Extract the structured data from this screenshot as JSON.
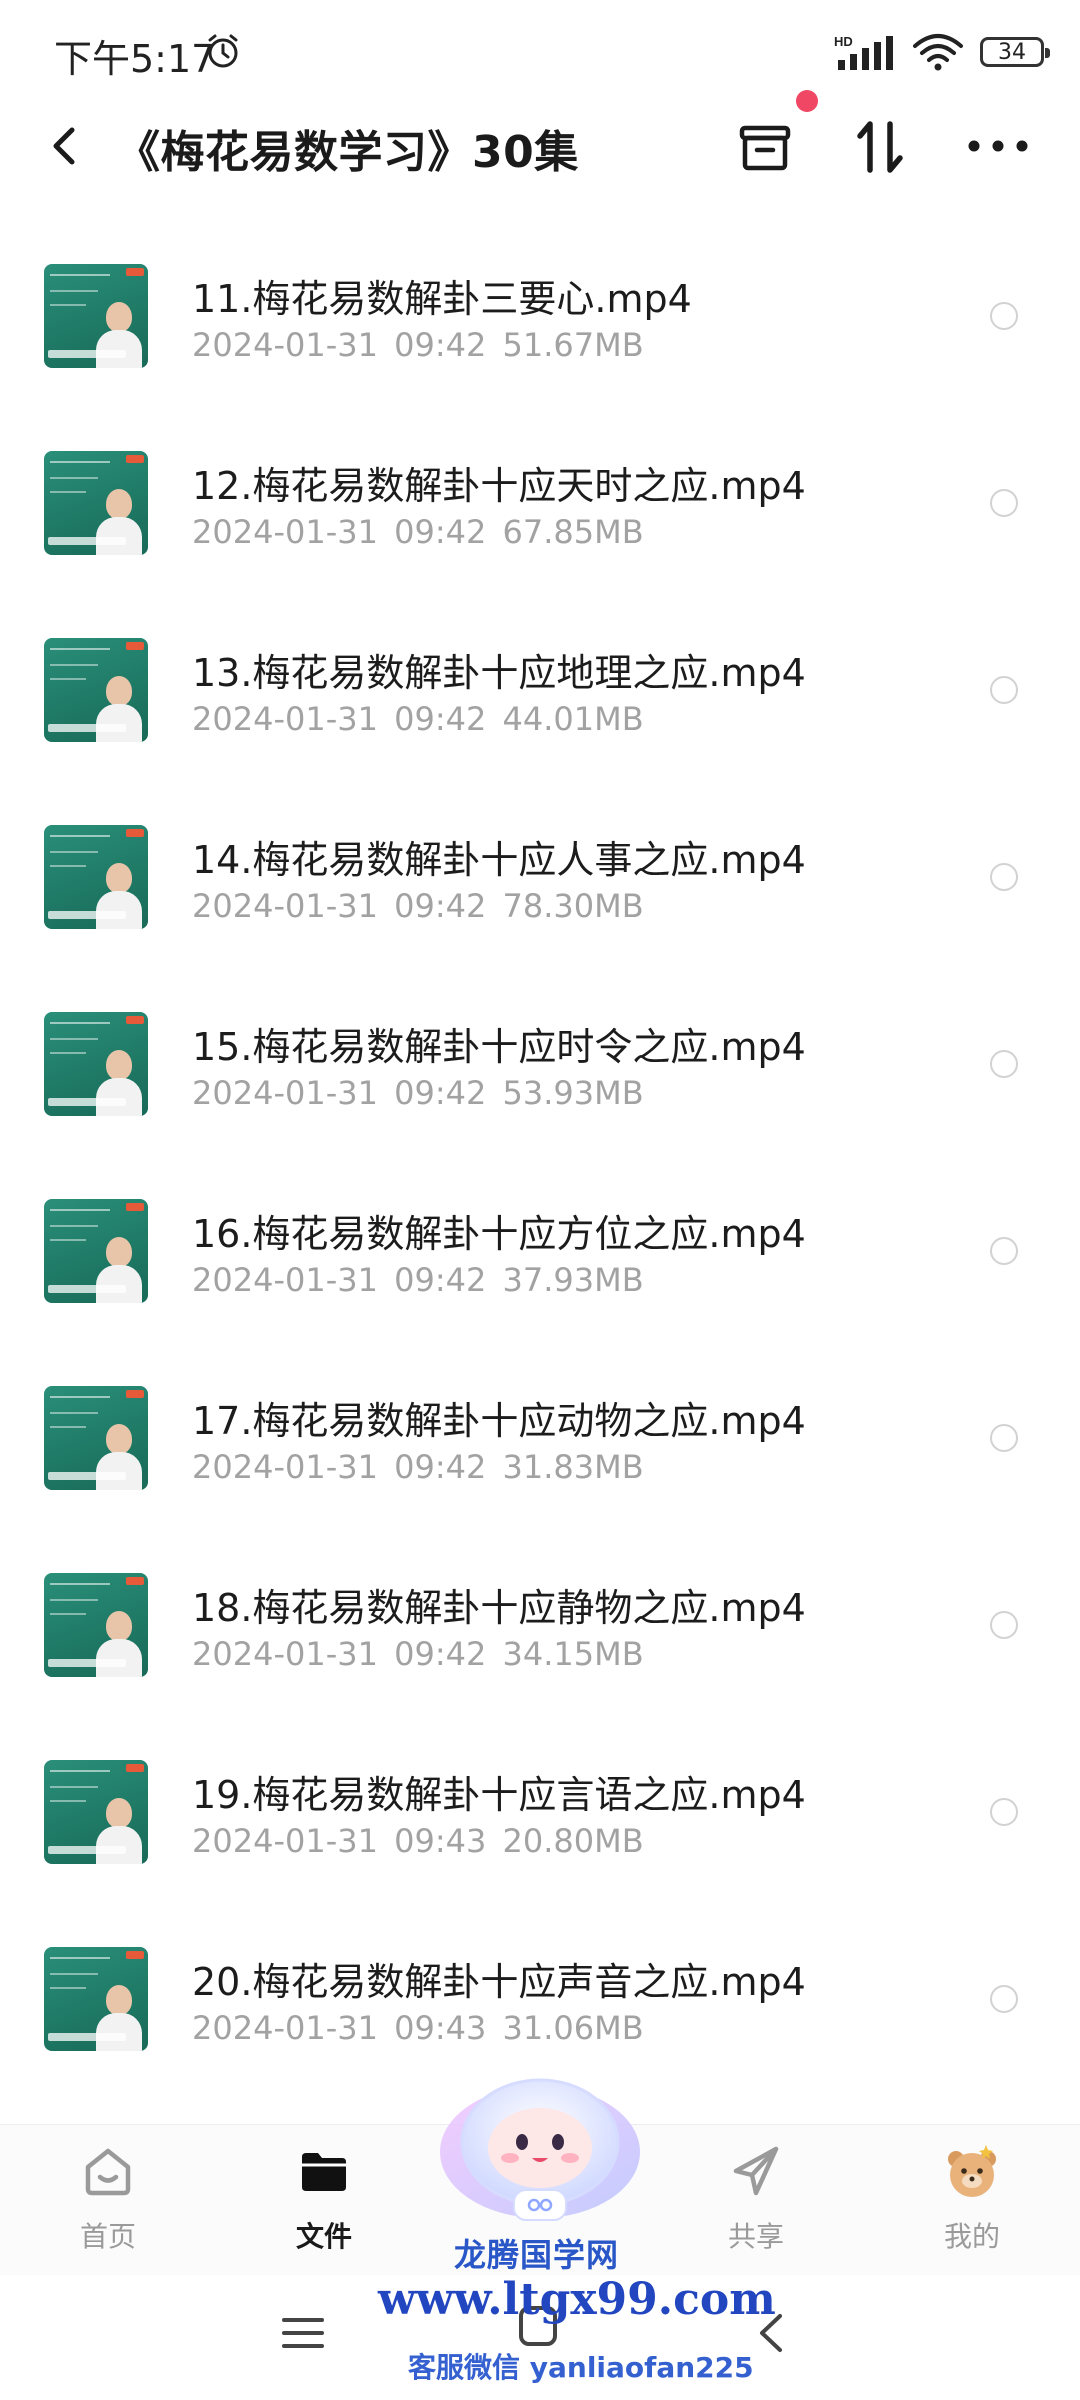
{
  "status_bar": {
    "time": "下午5:17",
    "battery": "34",
    "network_label": "HD"
  },
  "header": {
    "title": "《梅花易数学习》30集"
  },
  "files": [
    {
      "name": "11.梅花易数解卦三要心.mp4",
      "meta": "2024-01-31  09:42  51.67MB"
    },
    {
      "name": "12.梅花易数解卦十应天时之应.mp4",
      "meta": "2024-01-31  09:42  67.85MB"
    },
    {
      "name": "13.梅花易数解卦十应地理之应.mp4",
      "meta": "2024-01-31  09:42  44.01MB"
    },
    {
      "name": "14.梅花易数解卦十应人事之应.mp4",
      "meta": "2024-01-31  09:42  78.30MB"
    },
    {
      "name": "15.梅花易数解卦十应时令之应.mp4",
      "meta": "2024-01-31  09:42  53.93MB"
    },
    {
      "name": "16.梅花易数解卦十应方位之应.mp4",
      "meta": "2024-01-31  09:42  37.93MB"
    },
    {
      "name": "17.梅花易数解卦十应动物之应.mp4",
      "meta": "2024-01-31  09:42  31.83MB"
    },
    {
      "name": "18.梅花易数解卦十应静物之应.mp4",
      "meta": "2024-01-31  09:42  34.15MB"
    },
    {
      "name": "19.梅花易数解卦十应言语之应.mp4",
      "meta": "2024-01-31  09:43  20.80MB"
    },
    {
      "name": "20.梅花易数解卦十应声音之应.mp4",
      "meta": "2024-01-31  09:43  31.06MB"
    }
  ],
  "tabs": [
    {
      "label": "首页",
      "icon": "home-icon"
    },
    {
      "label": "文件",
      "icon": "folder-icon",
      "active": true
    },
    {
      "label": "共享",
      "icon": "send-icon"
    },
    {
      "label": "我的",
      "icon": "bear-avatar-icon"
    }
  ],
  "watermark": {
    "brand": "龙腾国学网",
    "url": "www.ltgx99.com",
    "contact": "客服微信 yanliaofan225"
  },
  "colors": {
    "accent_dot": "#f04764",
    "thumbnail_green": "#1f7a66",
    "meta_gray": "#a2a2a2",
    "watermark_blue": "#2146c0"
  }
}
